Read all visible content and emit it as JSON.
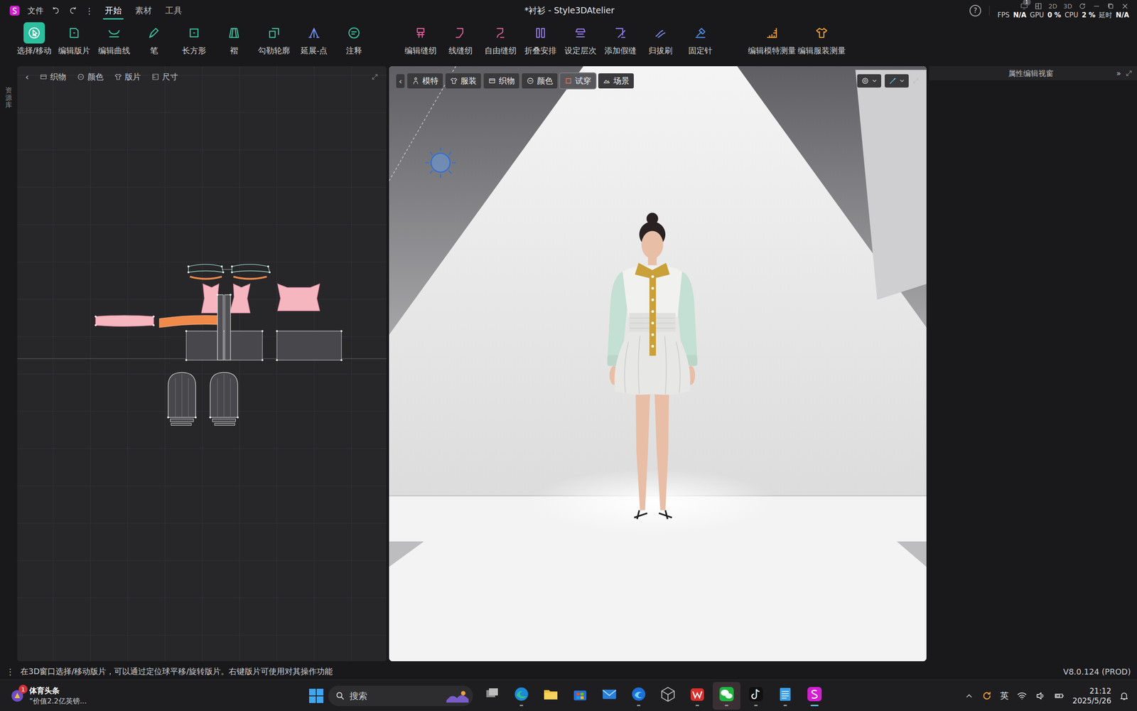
{
  "window": {
    "title": "*衬衫 - Style3DAtelier"
  },
  "menu": {
    "file": "文件",
    "more": "⋮"
  },
  "tabs": [
    {
      "label": "开始",
      "selected": true
    },
    {
      "label": "素材",
      "selected": false
    },
    {
      "label": "工具",
      "selected": false
    }
  ],
  "title_right": {
    "help": "?",
    "badge": "1",
    "view_2d": "2D",
    "view_3d": "3D"
  },
  "stats": [
    {
      "label": "FPS",
      "value": "N/A"
    },
    {
      "label": "GPU",
      "value": "0 %"
    },
    {
      "label": "CPU",
      "value": "2 %"
    },
    {
      "label": "延时",
      "value": "N/A"
    }
  ],
  "toolbar": {
    "groups": [
      {
        "tools": [
          {
            "label": "选择/移动",
            "selected": true
          },
          {
            "label": "编辑版片",
            "selected": false
          },
          {
            "label": "编辑曲线",
            "selected": false
          },
          {
            "label": "笔",
            "selected": false
          },
          {
            "label": "长方形",
            "selected": false
          },
          {
            "label": "褶",
            "selected": false
          },
          {
            "label": "勾勒轮廓",
            "selected": false
          },
          {
            "label": "延展-点",
            "selected": false
          },
          {
            "label": "注释",
            "selected": false
          }
        ]
      },
      {
        "tools": [
          {
            "label": "编辑缝纫",
            "selected": false
          },
          {
            "label": "线缝纫",
            "selected": false
          },
          {
            "label": "自由缝纫",
            "selected": false
          },
          {
            "label": "折叠安排",
            "selected": false
          },
          {
            "label": "设定层次",
            "selected": false
          },
          {
            "label": "添加假缝",
            "selected": false
          },
          {
            "label": "归拔刷",
            "selected": false
          },
          {
            "label": "固定针",
            "selected": false
          }
        ]
      },
      {
        "tools": [
          {
            "label": "编辑模特测量",
            "selected": false
          },
          {
            "label": "编辑服装测量",
            "selected": false
          }
        ]
      }
    ]
  },
  "side_strip": {
    "label": "资源库"
  },
  "panel2d": {
    "back": "‹",
    "tabs": [
      {
        "label": "织物"
      },
      {
        "label": "颜色"
      },
      {
        "label": "版片"
      },
      {
        "label": "尺寸"
      }
    ]
  },
  "panel3d": {
    "back": "‹",
    "tabs": [
      {
        "label": "模特",
        "selected": false
      },
      {
        "label": "服装",
        "selected": false
      },
      {
        "label": "织物",
        "selected": false
      },
      {
        "label": "颜色",
        "selected": false
      },
      {
        "label": "试穿",
        "selected": true
      },
      {
        "label": "场景",
        "selected": false
      }
    ]
  },
  "properties": {
    "title": "属性编辑视窗",
    "collapse": "»"
  },
  "status_bar": {
    "more": "⋮",
    "hint": "在3D窗口选择/移动版片，可以通过定位球平移/旋转版片。右键版片可使用对其操作功能",
    "version": "V8.0.124 (PROD)"
  },
  "taskbar": {
    "news": {
      "badge": "1",
      "title": "体育头条",
      "subtitle": "“价值2.2亿英镑..."
    },
    "search": {
      "placeholder": "搜索"
    },
    "apps": [
      {
        "running": false,
        "active": false
      },
      {
        "running": true,
        "active": false
      },
      {
        "running": false,
        "active": false
      },
      {
        "running": false,
        "active": false
      },
      {
        "running": false,
        "active": false
      },
      {
        "running": true,
        "active": false
      },
      {
        "running": false,
        "active": false
      },
      {
        "running": true,
        "active": false
      },
      {
        "running": true,
        "active": true
      },
      {
        "running": true,
        "active": false
      },
      {
        "running": true,
        "active": false
      },
      {
        "running": true,
        "active": true
      }
    ],
    "ime": "英",
    "time": "21:12",
    "date": "2025/5/26"
  }
}
